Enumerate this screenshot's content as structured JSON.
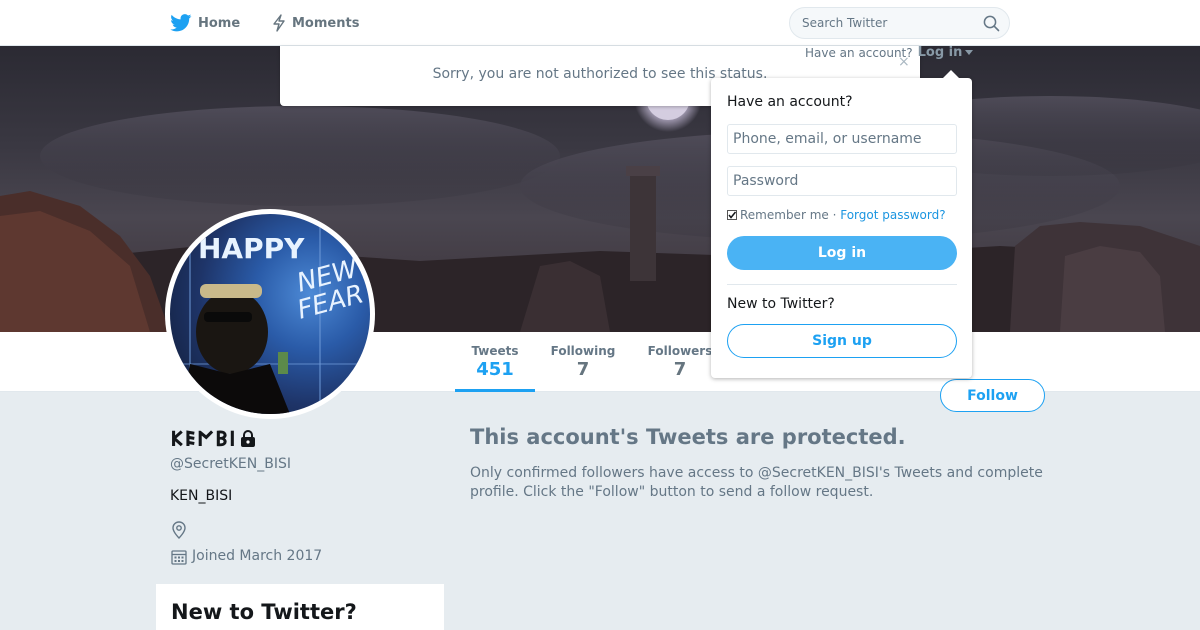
{
  "nav": {
    "home_label": "Home",
    "moments_label": "Moments",
    "search_placeholder": "Search Twitter"
  },
  "message": {
    "text": "Sorry, you are not authorized to see this status.",
    "close_symbol": "×"
  },
  "login": {
    "prompt": "Have an account?",
    "toggle_label": "Log in",
    "heading": "Have an account?",
    "username_placeholder": "Phone, email, or username",
    "password_placeholder": "Password",
    "remember_label": "Remember me",
    "separator": " · ",
    "forgot_label": "Forgot password?",
    "login_button": "Log in",
    "new_prompt": "New to Twitter?",
    "signup_button": "Sign up"
  },
  "stats": {
    "tweets_label": "Tweets",
    "tweets_value": "451",
    "following_label": "Following",
    "following_value": "7",
    "followers_label": "Followers",
    "followers_value": "7"
  },
  "follow_button": "Follow",
  "profile": {
    "name": "𐌊𐌄𐌍𐌁𐌉",
    "handle": "@SecretKEN_BISI",
    "bio": "KEN_BISI",
    "joined": "Joined March 2017"
  },
  "avatar": {
    "neon_text_1": "HAPPY",
    "neon_text_2": "NEW",
    "neon_text_3": "FEAR"
  },
  "signup_card": {
    "title": "New to Twitter?"
  },
  "protected": {
    "title": "This account's Tweets are protected.",
    "body": "Only confirmed followers have access to @SecretKEN_BISI's Tweets and complete profile. Click the \"Follow\" button to send a follow request."
  },
  "colors": {
    "brand_blue": "#1da1f2",
    "page_bg": "#e6ecf0"
  }
}
